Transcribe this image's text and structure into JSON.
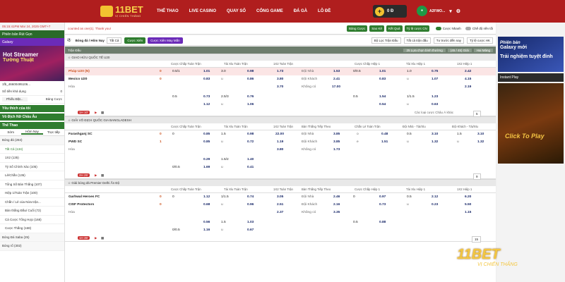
{
  "header": {
    "logo_text": "11BET",
    "logo_sub": "VỊ CHIẾN THẮNG",
    "nav": [
      "THỂ THAO",
      "LIVE CASINO",
      "QUAY SỐ",
      "CỔNG GAME",
      "ĐÁ GÀ",
      "LÔ ĐỀ"
    ],
    "balance": "0 Đ",
    "username": "A2FWO..."
  },
  "left": {
    "top_notice": "05:15:41PM Mar 24, 2025 GMT+7",
    "banner": "Phiên bản Rút Gọn",
    "galaxy": "Galaxy",
    "ad_line1": "Hot Streamer",
    "ad_line2": "Tường Thuật",
    "account": "1fb_46600495106...",
    "balance_label": "Số tiền khả dụng",
    "balance_val": "0",
    "bet_count": "Phiếu Đặt...",
    "bet_history": "Bảng Cược",
    "fav": "Yêu thích của tôi",
    "euro": "Vô Địch Nữ Châu Âu",
    "sports": "Thể Thao",
    "tabs": [
      "Sớm",
      "Hôm Nay",
      "Trực tiếp"
    ],
    "items": [
      {
        "t": "Bóng đá (284)",
        "grp": true
      },
      {
        "t": "Tất Cả (134)",
        "sel": true
      },
      {
        "t": "1X2 (135)"
      },
      {
        "t": "Tỷ Số Chính Xác (105)"
      },
      {
        "t": "Lẻ/Chẵn (136)"
      },
      {
        "t": "Tổng Số Bàn Thắng (107)"
      },
      {
        "t": "Hiệp 1/Toàn Trận (100)"
      },
      {
        "t": "Chẵn / Lẻ của Nửa trận..."
      },
      {
        "t": "Bàn thắng Đầu/ Cuối (72)"
      },
      {
        "t": "Cá Cược Tổng Hợp (168)"
      },
      {
        "t": "Cược Thắng (168)"
      },
      {
        "t": "Bóng Đá Saba (25)",
        "grp": true
      },
      {
        "t": "Bóng rổ (302)",
        "grp": true
      }
    ]
  },
  "topbar": {
    "notice": "counted as one(1). Thank you!",
    "btns": [
      "Bảng Cược",
      "Sao Kê",
      "Kết Quả",
      "Tỷ lệ cược CN"
    ],
    "opt1": "Cược Nhanh",
    "opt2": "Chế độ nền tối"
  },
  "filter": {
    "sport": "Bóng đá / Hôm Nay",
    "sel": "Tất Cả",
    "b1": "Cược Xiên",
    "b2": "Cược Xiên May Mắn",
    "f1": "Bộ Lọc Trận Đấu",
    "f2": "Tất cả trận đấu",
    "f3": "Tư trước đến nay",
    "f4": "Tỷ lệ cược HK"
  },
  "main": {
    "sec": "Trận Đấu",
    "sec_r1": "25 Lựa chọn bình thường",
    "sec_r2": "(45 / 45) Giải",
    "sec_r3": "Hai Mảng",
    "cols1": [
      "Cược Chấp Toàn Trận",
      "Tài Xỉu Toàn Trận",
      "1X2 Toàn Trận",
      "Cược Chấp Hiệp 1",
      "Tài Xỉu Hiệp 1",
      "1X2 Hiệp 1"
    ],
    "cols2": [
      "Cược Chấp Toàn Trận",
      "Tài Xỉu Toàn Trận",
      "1X2 Toàn Trận",
      "Bàn Thắng Tiếp Theo",
      "Chẵn Lẻ Toàn Trận",
      "Đội Nhà - Tài/Xỉu",
      "Đội Khách - Tài/Xỉu"
    ],
    "cols3": [
      "Cược Chấp Toàn Trận",
      "Tài Xỉu Toàn Trận",
      "1X2 Toàn Trận",
      "Bàn Thắng Tiếp Theo",
      "Cược Chấp Hiệp 1",
      "Tài Xỉu Hiệp 1",
      "1X2 Hiệp 1"
    ],
    "l1": "GIAO HỮU QUỐC TẾ U20",
    "l2": "GIẢI VÔ ĐỊCH QUỐC GIA BANGLADESH",
    "l3": "Giải bóng đá Premier Delhi Ấn Độ",
    "m1": {
      "home": "Pháp U20 (N)",
      "away": "Mexico U20",
      "draw": "Hòa",
      "hs": "0",
      "as": "0"
    },
    "m2": {
      "home": "Farashganj SC",
      "away": "PWD SC",
      "draw": "Hòa",
      "hs": "0",
      "as": "1"
    },
    "m3": {
      "home": "Garhwal Heroes FC",
      "away": "CISF Protectors",
      "draw": "Hòa",
      "hs": "0",
      "as": "0"
    },
    "bets_label": "Các loại cược Châu Á khác",
    "r1_count": "5",
    "r2_count": "9",
    "r3_count": "15",
    "badge1": "1H 10'",
    "badge2": "2H 25'",
    "badge3": "1H 35'"
  },
  "right": {
    "ad_a": "Phiên bản",
    "ad_b": "Galaxy mới",
    "ad_c": "Trải nghiệm tuyệt đỉnh",
    "instant": "Instant Play",
    "casino": "Click To Play",
    "wm": "11BET",
    "wm2": "VỊ CHIẾN THẮNG"
  }
}
